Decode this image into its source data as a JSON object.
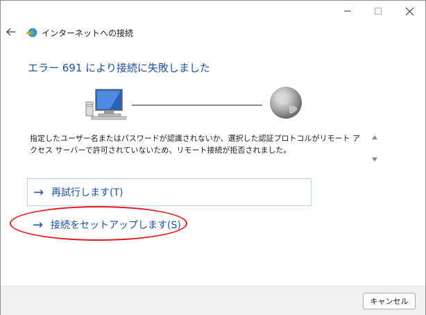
{
  "window": {
    "title": "インターネットへの接続",
    "controls": {
      "minimize": "minimize-icon",
      "maximize": "maximize-icon",
      "close": "close-icon"
    }
  },
  "nav": {
    "back_icon": "back-arrow-icon",
    "app_icon": "network-globe-icon"
  },
  "main": {
    "heading": "エラー 691 により接続に失敗しました",
    "illustration": {
      "left": "computer-icon",
      "right": "globe-icon"
    },
    "message": "指定したユーザー名またはパスワードが認識されないか、選択した認証プロトコルがリモート アクセス サーバーで許可されていないため、リモート接続が拒否されました。",
    "commands": [
      {
        "label": "再試行します(T)",
        "icon": "arrow-right-icon"
      },
      {
        "label": "接続をセットアップします(S)",
        "icon": "arrow-right-icon"
      }
    ]
  },
  "footer": {
    "cancel_label": "キャンセル"
  },
  "colors": {
    "heading": "#1c4f9c",
    "link": "#1c4f9c",
    "highlight_ring": "#e8161f",
    "footer_bg": "#f0f0f0"
  }
}
